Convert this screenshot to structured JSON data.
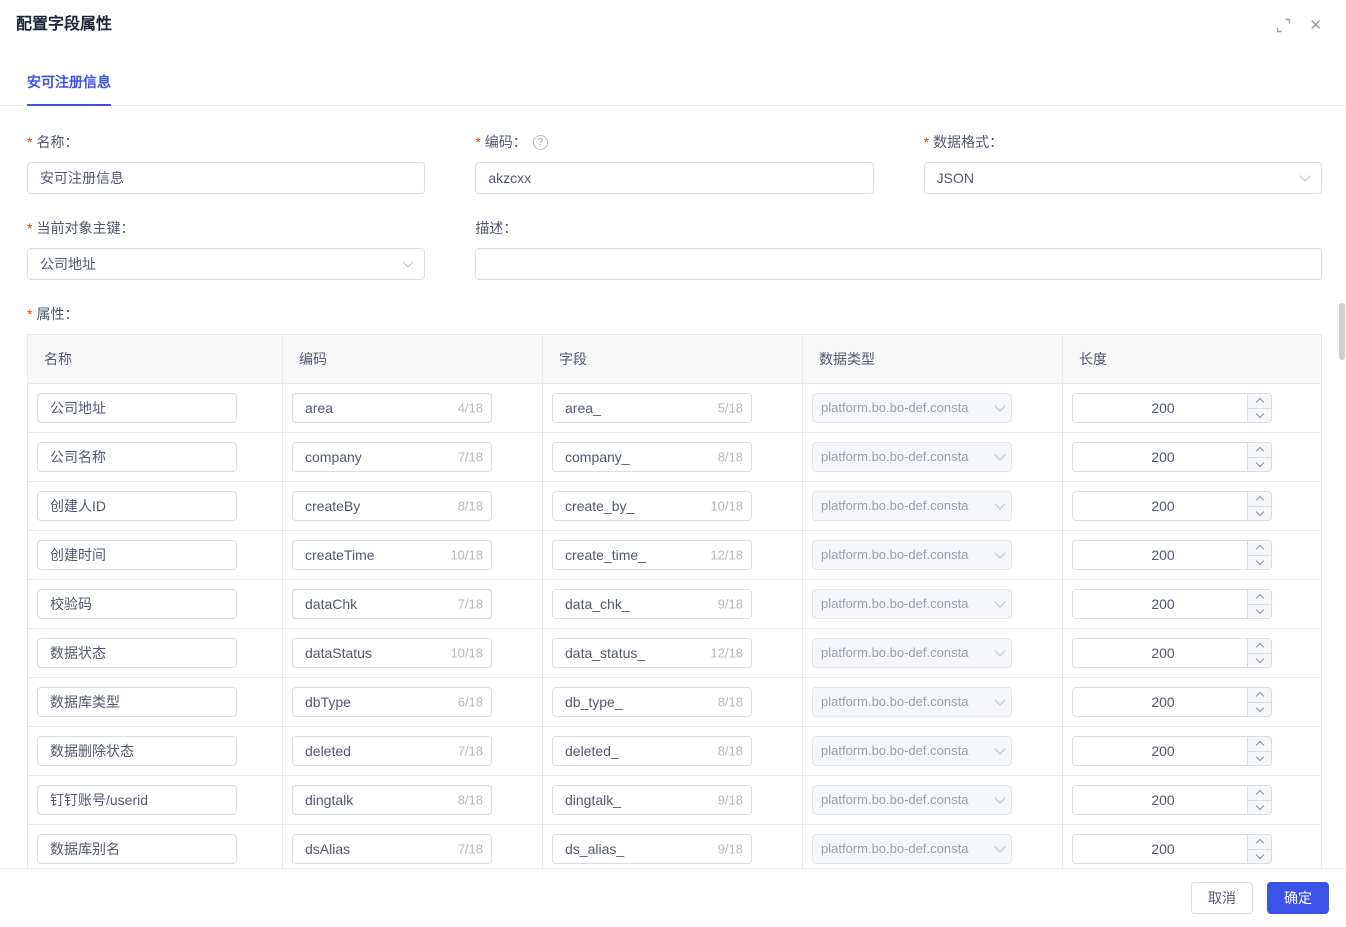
{
  "dialog": {
    "title": "配置字段属性"
  },
  "window_icons": {
    "close_glyph": "✕"
  },
  "required_mark": "*",
  "tabs": [
    {
      "label": "安可注册信息",
      "active": true
    }
  ],
  "form": {
    "name": {
      "label": "名称：",
      "value": "安可注册信息"
    },
    "code": {
      "label": "编码：",
      "value": "akzcxx",
      "help_glyph": "?"
    },
    "data_format": {
      "label": "数据格式：",
      "value": "JSON"
    },
    "primary_key": {
      "label": "当前对象主键：",
      "value": "公司地址"
    },
    "description": {
      "label": "描述：",
      "value": ""
    },
    "attributes_label": "属性："
  },
  "table": {
    "headers": [
      "名称",
      "编码",
      "字段",
      "数据类型",
      "长度"
    ],
    "rows": [
      {
        "name": "公司地址",
        "code": "area",
        "code_count": "4/18",
        "field": "area_",
        "field_count": "5/18",
        "data_type": "platform.bo.bo-def.consta",
        "length": "200"
      },
      {
        "name": "公司名称",
        "code": "company",
        "code_count": "7/18",
        "field": "company_",
        "field_count": "8/18",
        "data_type": "platform.bo.bo-def.consta",
        "length": "200"
      },
      {
        "name": "创建人ID",
        "code": "createBy",
        "code_count": "8/18",
        "field": "create_by_",
        "field_count": "10/18",
        "data_type": "platform.bo.bo-def.consta",
        "length": "200"
      },
      {
        "name": "创建时间",
        "code": "createTime",
        "code_count": "10/18",
        "field": "create_time_",
        "field_count": "12/18",
        "data_type": "platform.bo.bo-def.consta",
        "length": "200"
      },
      {
        "name": "校验码",
        "code": "dataChk",
        "code_count": "7/18",
        "field": "data_chk_",
        "field_count": "9/18",
        "data_type": "platform.bo.bo-def.consta",
        "length": "200"
      },
      {
        "name": "数据状态",
        "code": "dataStatus",
        "code_count": "10/18",
        "field": "data_status_",
        "field_count": "12/18",
        "data_type": "platform.bo.bo-def.consta",
        "length": "200"
      },
      {
        "name": "数据库类型",
        "code": "dbType",
        "code_count": "6/18",
        "field": "db_type_",
        "field_count": "8/18",
        "data_type": "platform.bo.bo-def.consta",
        "length": "200"
      },
      {
        "name": "数据删除状态",
        "code": "deleted",
        "code_count": "7/18",
        "field": "deleted_",
        "field_count": "8/18",
        "data_type": "platform.bo.bo-def.consta",
        "length": "200"
      },
      {
        "name": "钉钉账号/userid",
        "code": "dingtalk",
        "code_count": "8/18",
        "field": "dingtalk_",
        "field_count": "9/18",
        "data_type": "platform.bo.bo-def.consta",
        "length": "200"
      },
      {
        "name": "数据库别名",
        "code": "dsAlias",
        "code_count": "7/18",
        "field": "ds_alias_",
        "field_count": "9/18",
        "data_type": "platform.bo.bo-def.consta",
        "length": "200"
      },
      {
        "name": "",
        "code": "",
        "code_count": "",
        "field": "",
        "field_count": "",
        "data_type": "",
        "length": ""
      }
    ]
  },
  "footer": {
    "cancel_label": "取消",
    "confirm_label": "确定"
  },
  "colors": {
    "primary": "#3d52e6",
    "required": "#ed4014"
  }
}
